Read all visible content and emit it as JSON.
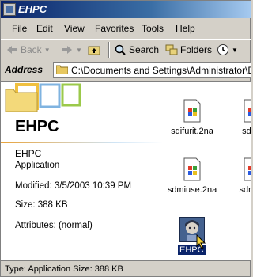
{
  "window": {
    "title": "EHPC"
  },
  "menu": [
    "File",
    "Edit",
    "View",
    "Favorites",
    "Tools",
    "Help"
  ],
  "toolbar": {
    "back": "Back",
    "search": "Search",
    "folders": "Folders"
  },
  "address": {
    "label": "Address",
    "path": "C:\\Documents and Settings\\Administrator\\Desk"
  },
  "details": {
    "title": "EHPC",
    "name": "EHPC",
    "type": "Application",
    "modified": "Modified: 3/5/2003 10:39 PM",
    "size": "Size: 388 KB",
    "attributes": "Attributes: (normal)"
  },
  "files": [
    "sdifurit.2na",
    "sdish",
    "sdmiuse.2na",
    "sdnam",
    "EHPC"
  ],
  "status": "Type: Application Size: 388 KB",
  "colors": {
    "titlebar": "#0a246a",
    "selection": "#0a246a",
    "chrome": "#d4d0c8"
  }
}
